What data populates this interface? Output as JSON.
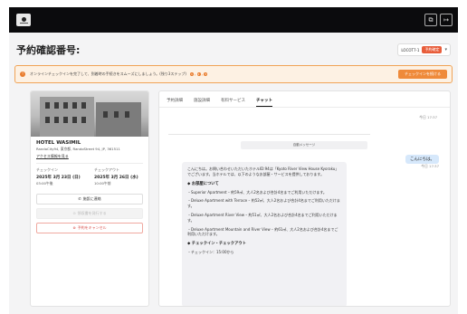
{
  "header": {
    "logo_icon": "hotel-logo-icon",
    "icons": [
      "share-icon",
      "exit-icon"
    ]
  },
  "page": {
    "title": "予約確認番号:",
    "booking_id": "LOCOT7-1",
    "booking_status": "予約確定"
  },
  "banner": {
    "text": "オンラインチェックインを完了して、到着時の手続きをスムーズにしましょう。(残り3ステップ)",
    "steps": [
      "1",
      "2",
      "3"
    ],
    "button": "チェックインを続ける"
  },
  "hotel": {
    "name": "HOTEL WASIMIL",
    "address": "RandoCity94, 東京都, RandoStreet 94, JP, 361511",
    "access_link": "アクセス情報を見る",
    "checkin_label": "チェックイン",
    "checkin_date": "2025年 3月 23日 (日)",
    "checkin_time": "03:00午後",
    "checkout_label": "チェックアウト",
    "checkout_date": "2025年 3月 26日 (水)",
    "checkout_time": "10:00午前",
    "contact_button": "施設に連絡",
    "receipt_button": "領収書を発行する",
    "cancel_button": "予約をキャンセル"
  },
  "tabs": [
    "予約詳細",
    "施設詳細",
    "有料サービス",
    "チャット"
  ],
  "chat": {
    "timestamp_top": "今日 17:37",
    "system_label": "自動メッセージ",
    "user_message": "こんにちは。",
    "user_time": "今日 17:37",
    "messages": [
      "こんにちは。お問い合わせいただいたホテルID:94は「Kyoto River View House Kyoraku」でございます。当ホテルでは、以下のようなお部屋・サービスを提供しております。",
      "◆ お部屋について",
      "・Superior Apartment – 約59㎡、大人2名および合計4名までご利用いただけます。",
      "・Deluxe Apartment with Terrace – 約52㎡、大人2名および合計4名までご利用いただけます。",
      "・Deluxe Apartment River View – 約51㎡、大人2名および合計4名までご利用いただけます。",
      "・Deluxe Apartment Mountain and River View – 約61㎡、大人2名および合計4名までご利用いただけます。",
      "◆ チェックイン・チェックアウト",
      "・チェックイン：15:00から"
    ]
  }
}
